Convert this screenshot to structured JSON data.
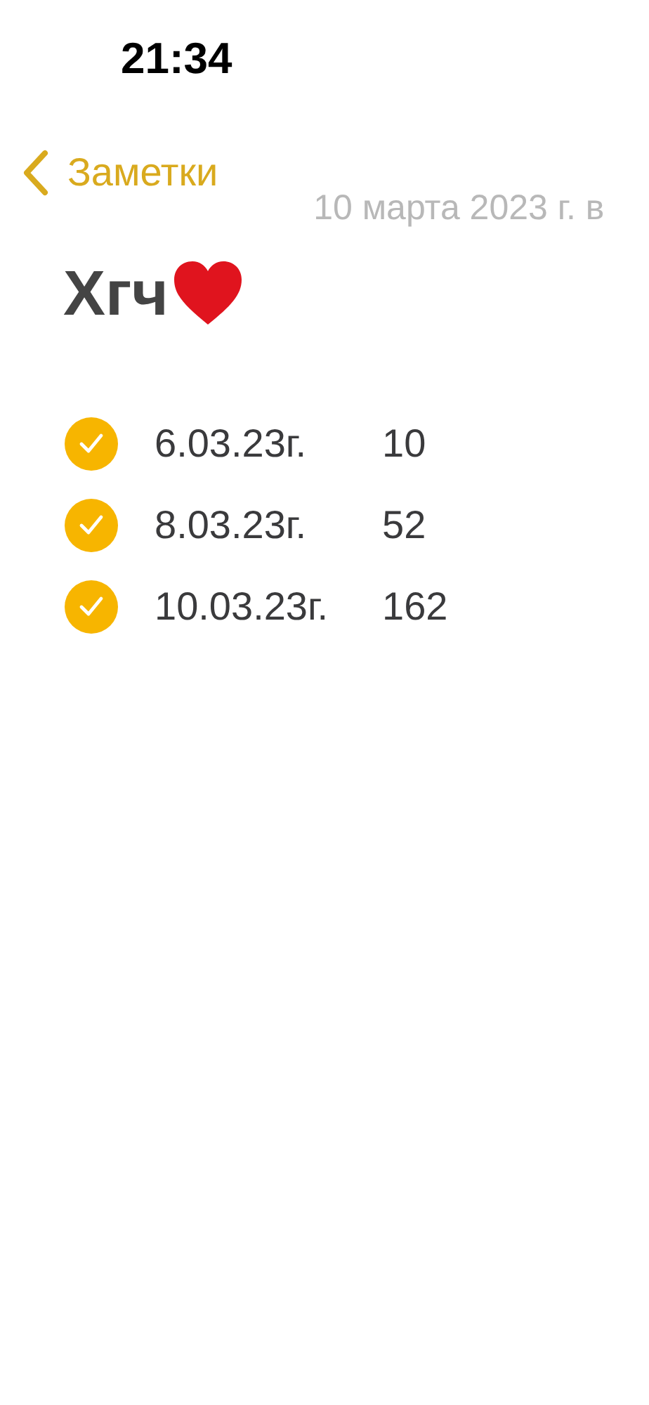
{
  "status_bar": {
    "time": "21:34"
  },
  "nav": {
    "back_label": "Заметки",
    "date": "10 марта 2023 г. в"
  },
  "note": {
    "title": "Хгч",
    "checklist": [
      {
        "checked": true,
        "date": "6.03.23г.",
        "value": "10"
      },
      {
        "checked": true,
        "date": "8.03.23г.",
        "value": "52"
      },
      {
        "checked": true,
        "date": "10.03.23г.",
        "value": "162"
      }
    ]
  }
}
